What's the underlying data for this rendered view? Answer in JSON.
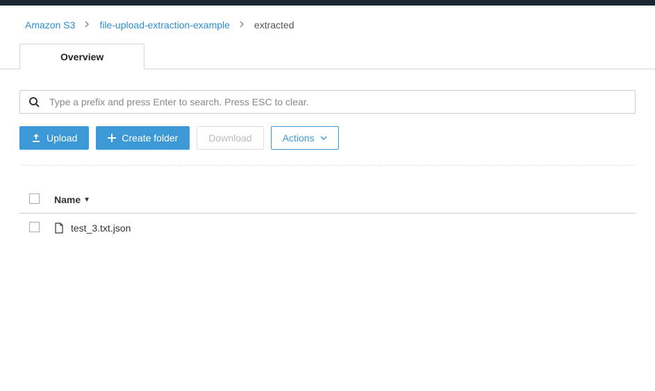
{
  "breadcrumb": {
    "items": [
      {
        "label": "Amazon S3",
        "link": true
      },
      {
        "label": "file-upload-extraction-example",
        "link": true
      },
      {
        "label": "extracted",
        "link": false
      }
    ]
  },
  "tabs": {
    "overview": "Overview"
  },
  "search": {
    "placeholder": "Type a prefix and press Enter to search. Press ESC to clear."
  },
  "toolbar": {
    "upload": "Upload",
    "create_folder": "Create folder",
    "download": "Download",
    "actions": "Actions"
  },
  "table": {
    "header": {
      "name": "Name"
    },
    "rows": [
      {
        "name": "test_3.txt.json"
      }
    ]
  }
}
